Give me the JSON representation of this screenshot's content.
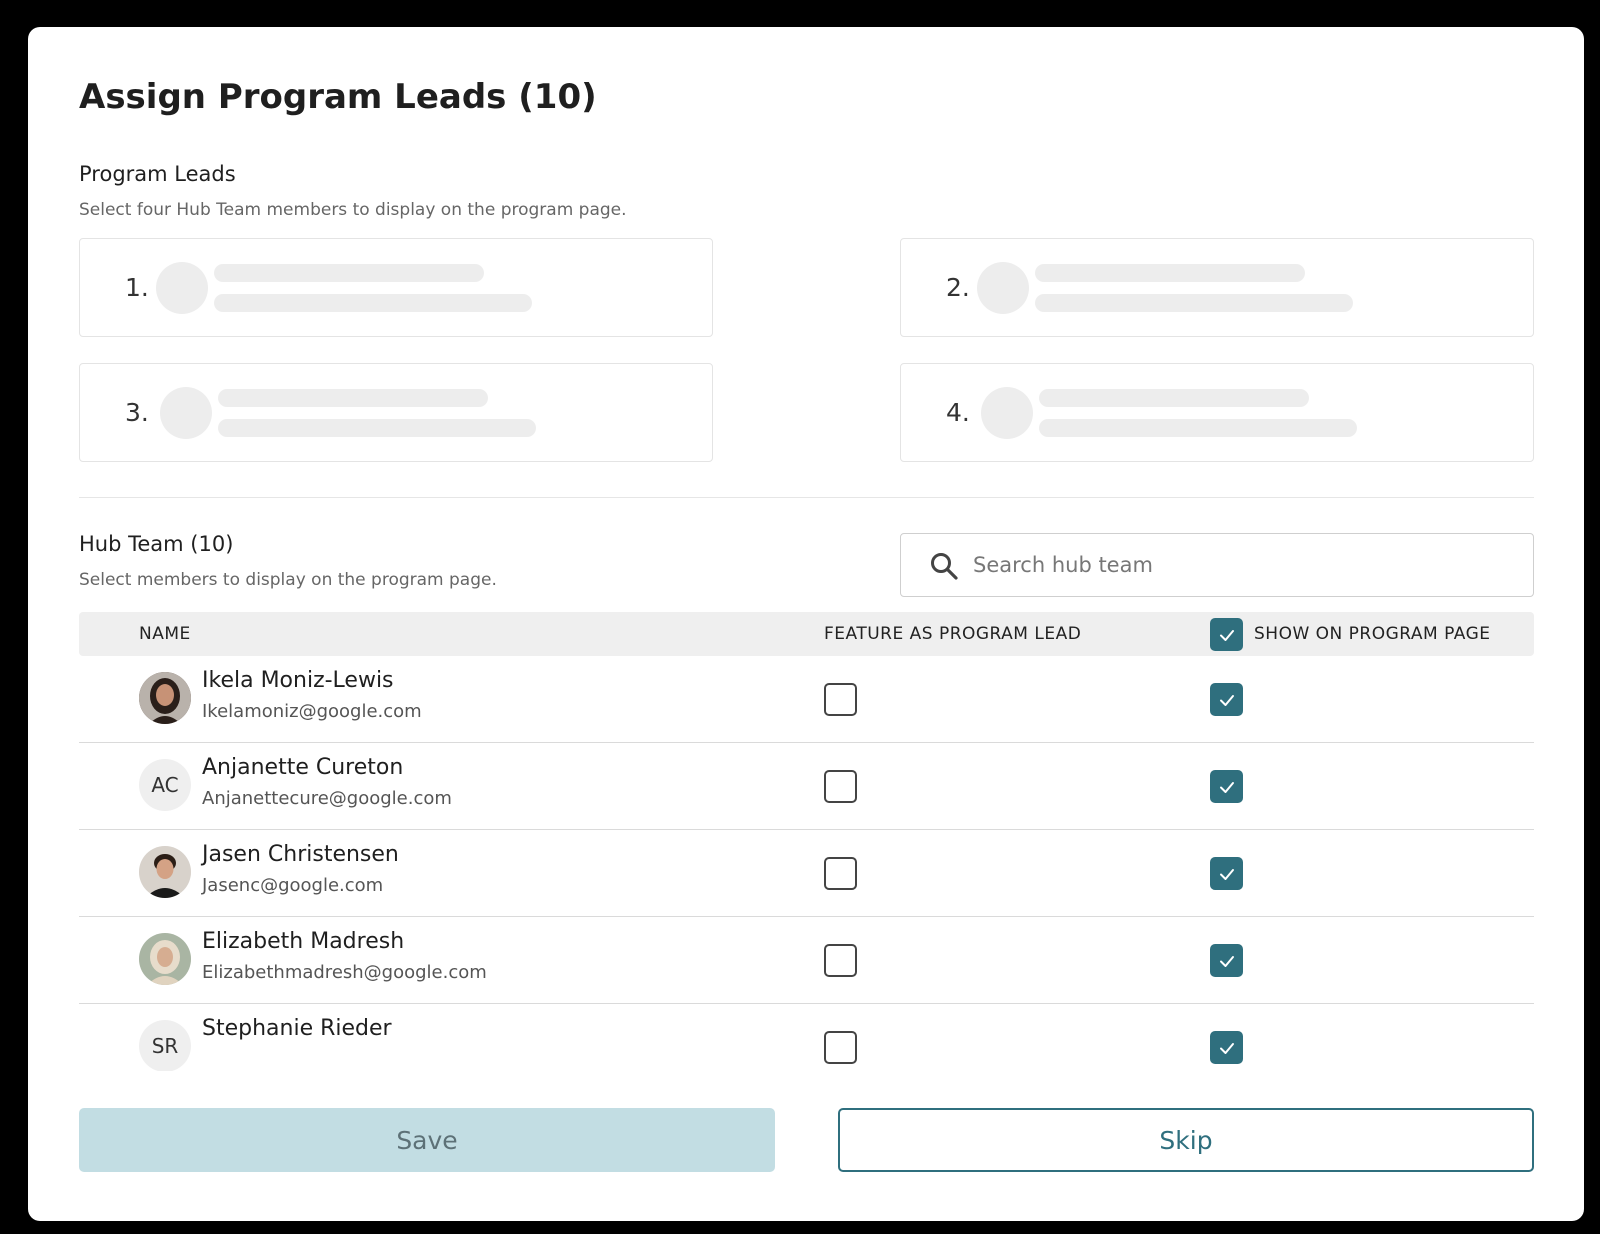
{
  "modal": {
    "title": "Assign Program Leads  (10)"
  },
  "program_leads": {
    "title": "Program Leads",
    "subtitle": "Select four Hub Team members to display on the program page.",
    "slots": [
      "1.",
      "2.",
      "3.",
      "4."
    ]
  },
  "hub_team": {
    "title": "Hub Team (10)",
    "subtitle": "Select members to display on the program page.",
    "search_placeholder": "Search hub team",
    "columns": {
      "name": "NAME",
      "feature": "FEATURE AS PROGRAM LEAD",
      "show": "SHOW ON PROGRAM PAGE"
    },
    "show_all_checked": true,
    "members": [
      {
        "name": "Ikela Moniz-Lewis",
        "email": "Ikelamoniz@google.com",
        "initials": "",
        "feature": false,
        "show": true
      },
      {
        "name": "Anjanette Cureton",
        "email": "Anjanettecure@google.com",
        "initials": "AC",
        "feature": false,
        "show": true
      },
      {
        "name": "Jasen Christensen",
        "email": "Jasenc@google.com",
        "initials": "",
        "feature": false,
        "show": true
      },
      {
        "name": "Elizabeth Madresh",
        "email": "Elizabethmadresh@google.com",
        "initials": "",
        "feature": false,
        "show": true
      },
      {
        "name": "Stephanie Rieder",
        "email": "",
        "initials": "SR",
        "feature": false,
        "show": true
      }
    ]
  },
  "actions": {
    "save_label": "Save",
    "skip_label": "Skip"
  },
  "colors": {
    "accent": "#2f6f7e",
    "save_disabled_bg": "#c2dde3"
  }
}
